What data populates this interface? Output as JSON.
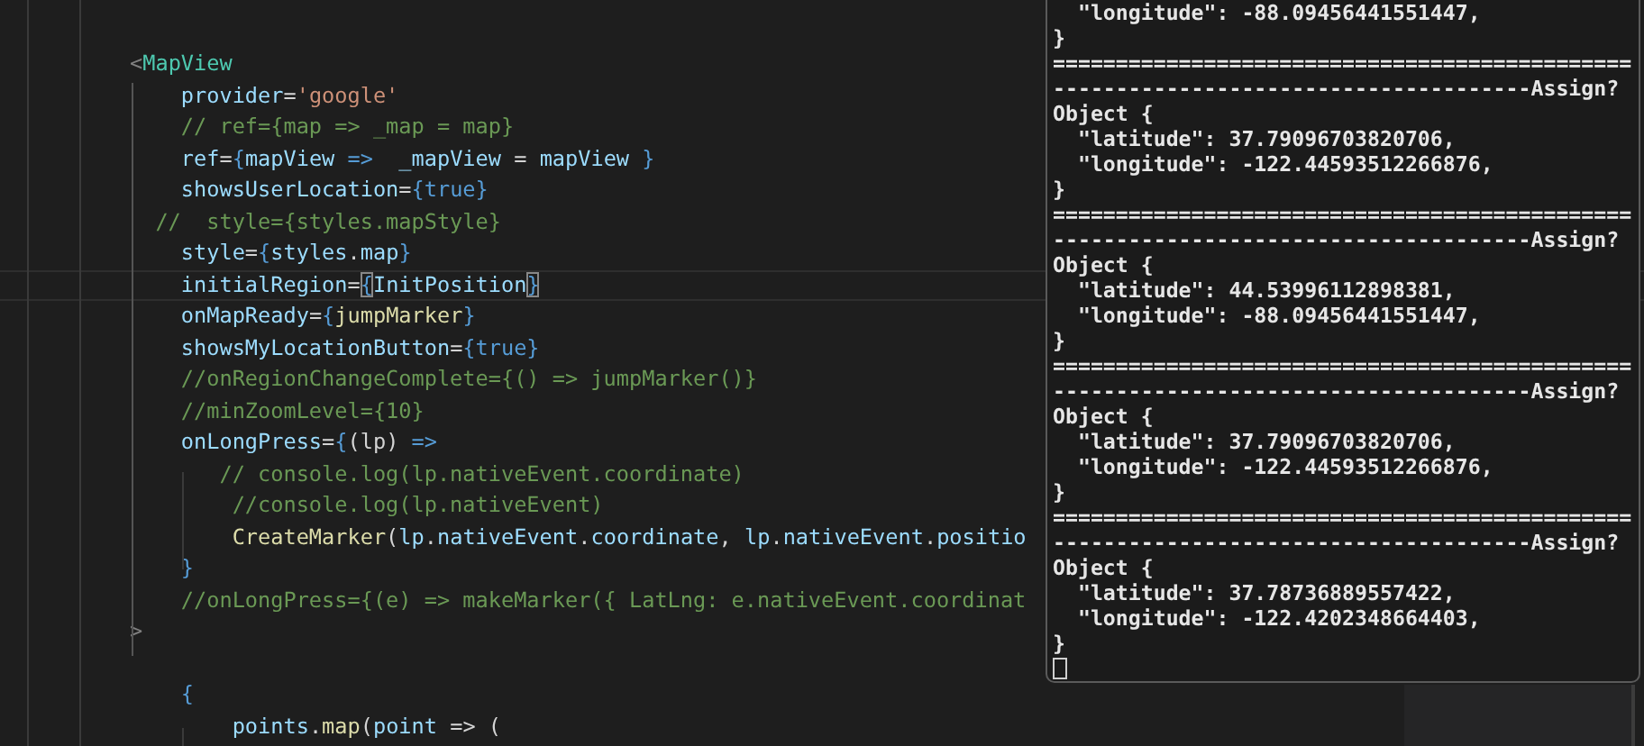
{
  "editor": {
    "lines": [
      {
        "tokens": [
          {
            "text": "<",
            "kind": "punct"
          },
          {
            "text": "MapView",
            "kind": "tag"
          }
        ]
      },
      {
        "tokens": [
          {
            "text": "    provider",
            "kind": "attr"
          },
          {
            "text": "=",
            "kind": "op"
          },
          {
            "text": "'google'",
            "kind": "str"
          }
        ]
      },
      {
        "tokens": [
          {
            "text": "    // ref={map => _map = map}",
            "kind": "comment"
          }
        ]
      },
      {
        "tokens": [
          {
            "text": "    ref",
            "kind": "attr"
          },
          {
            "text": "=",
            "kind": "op"
          },
          {
            "text": "{",
            "kind": "brace"
          },
          {
            "text": "mapView",
            "kind": "var"
          },
          {
            "text": " =>  ",
            "kind": "brace"
          },
          {
            "text": "_mapView",
            "kind": "var"
          },
          {
            "text": " = ",
            "kind": "op"
          },
          {
            "text": "mapView",
            "kind": "var"
          },
          {
            "text": " }",
            "kind": "brace"
          }
        ]
      },
      {
        "tokens": [
          {
            "text": "    showsUserLocation",
            "kind": "attr"
          },
          {
            "text": "=",
            "kind": "op"
          },
          {
            "text": "{true}",
            "kind": "brace"
          }
        ]
      },
      {
        "tokens": [
          {
            "text": "  //  style={styles.mapStyle}",
            "kind": "comment"
          }
        ]
      },
      {
        "tokens": [
          {
            "text": "    style",
            "kind": "attr"
          },
          {
            "text": "=",
            "kind": "op"
          },
          {
            "text": "{",
            "kind": "brace"
          },
          {
            "text": "styles",
            "kind": "var"
          },
          {
            "text": ".",
            "kind": "op"
          },
          {
            "text": "map",
            "kind": "var"
          },
          {
            "text": "}",
            "kind": "brace"
          }
        ]
      },
      {
        "current": true,
        "tokens": [
          {
            "text": "    initialRegion",
            "kind": "attr"
          },
          {
            "text": "=",
            "kind": "op"
          },
          {
            "text": "{",
            "kind": "match"
          },
          {
            "text": "InitPosition",
            "kind": "var"
          },
          {
            "text": "}",
            "kind": "match"
          }
        ]
      },
      {
        "tokens": [
          {
            "text": "    onMapReady",
            "kind": "attr"
          },
          {
            "text": "=",
            "kind": "op"
          },
          {
            "text": "{",
            "kind": "brace"
          },
          {
            "text": "jumpMarker",
            "kind": "fn"
          },
          {
            "text": "}",
            "kind": "brace"
          }
        ]
      },
      {
        "tokens": [
          {
            "text": "    showsMyLocationButton",
            "kind": "attr"
          },
          {
            "text": "=",
            "kind": "op"
          },
          {
            "text": "{true}",
            "kind": "brace"
          }
        ]
      },
      {
        "tokens": [
          {
            "text": "    //onRegionChangeComplete={() => jumpMarker()}",
            "kind": "comment"
          }
        ]
      },
      {
        "tokens": [
          {
            "text": "    //minZoomLevel={10}",
            "kind": "comment"
          }
        ]
      },
      {
        "tokens": [
          {
            "text": "    onLongPress",
            "kind": "attr"
          },
          {
            "text": "=",
            "kind": "op"
          },
          {
            "text": "{",
            "kind": "brace"
          },
          {
            "text": "(lp)",
            "kind": "op"
          },
          {
            "text": " =>",
            "kind": "brace"
          }
        ]
      },
      {
        "tokens": [
          {
            "text": "       // console.log(lp.nativeEvent.coordinate)",
            "kind": "comment"
          }
        ]
      },
      {
        "tokens": [
          {
            "text": "        //console.log(lp.nativeEvent)",
            "kind": "comment"
          }
        ]
      },
      {
        "tokens": [
          {
            "text": "        CreateMarker",
            "kind": "fn"
          },
          {
            "text": "(",
            "kind": "op"
          },
          {
            "text": "lp",
            "kind": "var"
          },
          {
            "text": ".",
            "kind": "op"
          },
          {
            "text": "nativeEvent",
            "kind": "var"
          },
          {
            "text": ".",
            "kind": "op"
          },
          {
            "text": "coordinate",
            "kind": "var"
          },
          {
            "text": ", ",
            "kind": "op"
          },
          {
            "text": "lp",
            "kind": "var"
          },
          {
            "text": ".",
            "kind": "op"
          },
          {
            "text": "nativeEvent",
            "kind": "var"
          },
          {
            "text": ".",
            "kind": "op"
          },
          {
            "text": "positio",
            "kind": "var"
          }
        ]
      },
      {
        "tokens": [
          {
            "text": "    }",
            "kind": "brace"
          }
        ]
      },
      {
        "tokens": [
          {
            "text": "    //onLongPress={(e) => makeMarker({ LatLng: e.nativeEvent.coordinat",
            "kind": "comment"
          }
        ]
      },
      {
        "tokens": [
          {
            "text": ">",
            "kind": "punct"
          }
        ]
      },
      {
        "spaced": true,
        "tokens": [
          {
            "text": "    {",
            "kind": "brace"
          }
        ]
      },
      {
        "tokens": [
          {
            "text": "        points",
            "kind": "var"
          },
          {
            "text": ".",
            "kind": "op"
          },
          {
            "text": "map",
            "kind": "fn"
          },
          {
            "text": "(",
            "kind": "op"
          },
          {
            "text": "point",
            "kind": "var"
          },
          {
            "text": " => (",
            "kind": "op"
          }
        ]
      }
    ]
  },
  "terminal": {
    "lines": [
      "  \"longitude\": -88.09456441551447,",
      "}",
      "==============================================",
      "--------------------------------------Assign?",
      "Object {",
      "  \"latitude\": 37.79096703820706,",
      "  \"longitude\": -122.44593512266876,",
      "}",
      "==============================================",
      "--------------------------------------Assign?",
      "Object {",
      "  \"latitude\": 44.53996112898381,",
      "  \"longitude\": -88.09456441551447,",
      "}",
      "==============================================",
      "--------------------------------------Assign?",
      "Object {",
      "  \"latitude\": 37.79096703820706,",
      "  \"longitude\": -122.44593512266876,",
      "}",
      "==============================================",
      "--------------------------------------Assign?",
      "Object {",
      "  \"latitude\": 37.78736889557422,",
      "  \"longitude\": -122.4202348664403,",
      "}"
    ]
  }
}
